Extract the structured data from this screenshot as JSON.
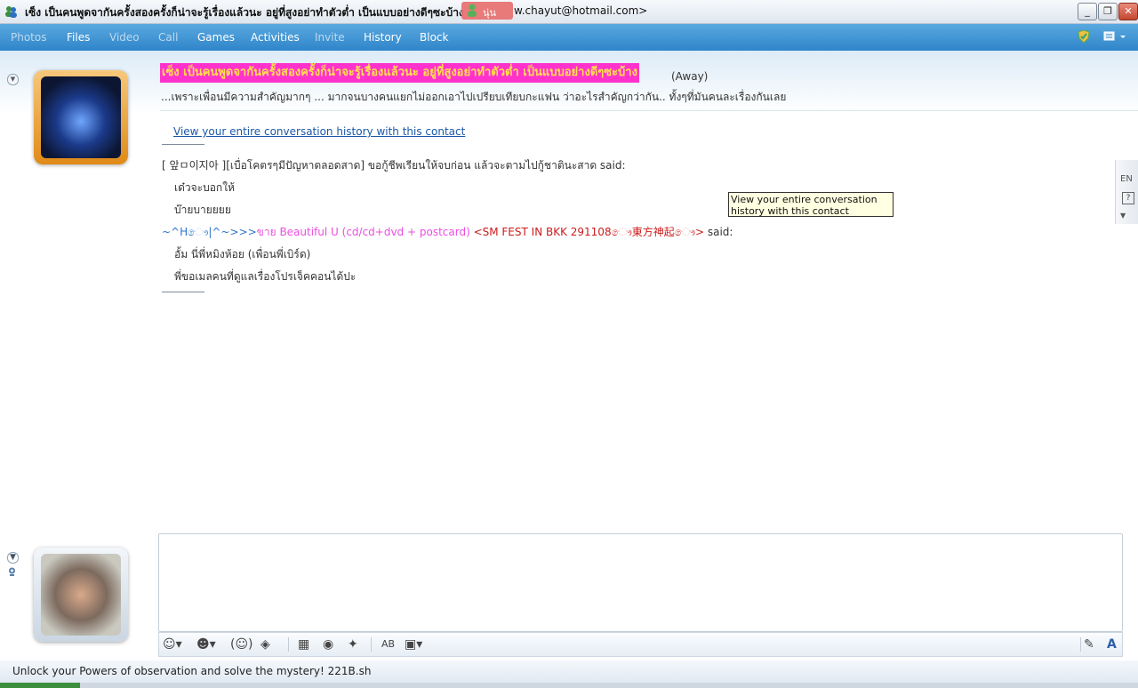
{
  "window": {
    "title": "เซ็ง เป็นคนพูดจากันครั้งสองครั้งก็น่าจะรู้เรื่องแล้วนะ อยู่ที่สูงอย่าทำตัวต่ำ เป็นแบบอย่างดีๆซะบ้าง",
    "pill_text": "นุ่น",
    "email": "w.chayut@hotmail.com>",
    "minimize": "_",
    "restore": "❐",
    "close": "✕"
  },
  "menu": {
    "items": [
      {
        "label": "Photos",
        "enabled": false
      },
      {
        "label": "Files",
        "enabled": true
      },
      {
        "label": "Video",
        "enabled": false
      },
      {
        "label": "Call",
        "enabled": false
      },
      {
        "label": "Games",
        "enabled": true
      },
      {
        "label": "Activities",
        "enabled": true
      },
      {
        "label": "Invite",
        "enabled": false
      },
      {
        "label": "History",
        "enabled": true
      },
      {
        "label": "Block",
        "enabled": true
      }
    ]
  },
  "contact": {
    "display_name": "เซ็ง เป็นคนพูดจากันครั้งสองครั้งก็น่าจะรู้เรื่องแล้วนะ อยู่ที่สูงอย่าทำตัวต่ำ เป็นแบบอย่างดีๆซะบ้าง",
    "status": "(Away)",
    "personal_message": "...เพราะเพื่อนมีความสำคัญมากๆ  ... มากจนบางคนแยกไม่ออกเอาไปเปรียบเทียบกะแฟน ว่าอะไรสำคัญกว่ากัน.. ทั้งๆที่มันคนละเรื่องกันเลย"
  },
  "conversation": {
    "history_link": "View your entire conversation history with this contact",
    "sender1": "[ 앞ㅁ이지아 ][เบื่อโคตรๆมีปัญหาตลอดสาด] ขอกู้ชีพเรียนให้จบก่อน แล้วจะตามไปกู้ชาตินะสาด said:",
    "msg1": "เด๋วจะบอกให้",
    "msg2": "บ๊ายบายยยย",
    "sender2_part1": "~^Hෞ|^~>>>",
    "sender2_part2": "ขาย Beautiful U (cd/cd+dvd + postcard)",
    "sender2_part3": " <SM FEST IN BKK 291108ෞ東方神起ෞ>",
    "sender2_said": " said:",
    "msg3": "อั้ม นี่พี่หมิงห้อย (เพื่อนพี่เบิร์ด)",
    "msg4": "พี่ขอเมลคนที่ดูแลเรื่องโปรเจ็คคอนได้ปะ"
  },
  "tooltip": {
    "text": "View your entire conversation history with this contact"
  },
  "sidebar": {
    "lang": "EN",
    "help": "?"
  },
  "banner": {
    "text": "Unlock your Powers of observation and solve the mystery! 221B.sh"
  },
  "colors": {
    "menu_bg": "#2f85c9",
    "name_bg": "#ff33cc",
    "name_fg": "#ffe14a",
    "link": "#1a58a8"
  }
}
